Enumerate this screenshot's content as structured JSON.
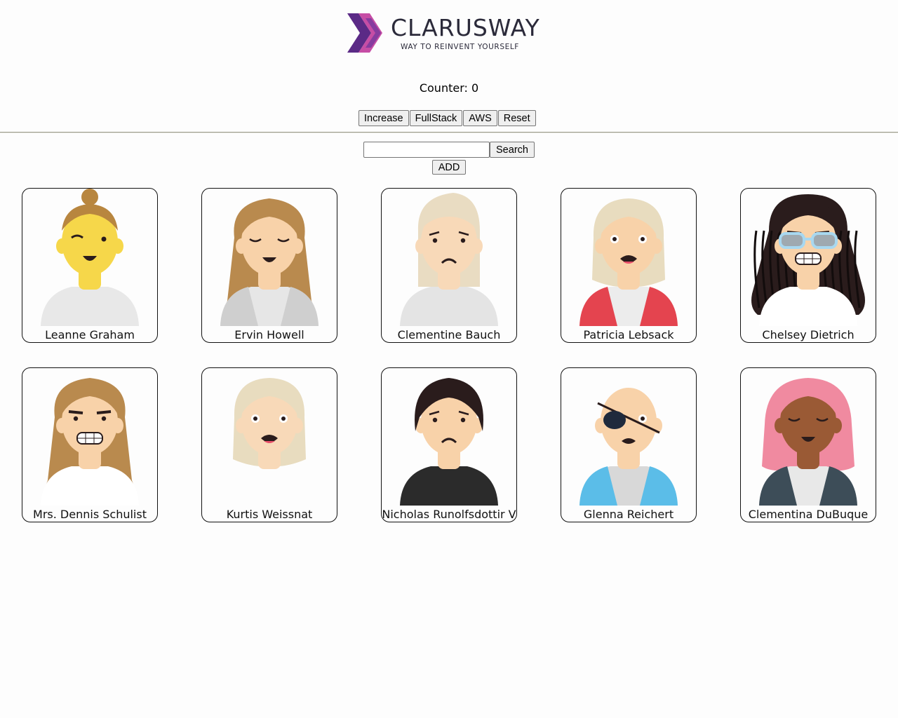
{
  "logo": {
    "name": "CLARUSWAY",
    "tagline": "WAY TO REINVENT YOURSELF",
    "colors": {
      "chevron_dark": "#5b2a86",
      "chevron_light": "#c03a9b",
      "text": "#2b2a3a"
    }
  },
  "counter": {
    "label": "Counter: 0"
  },
  "buttons": {
    "increase": "Increase",
    "fullstack": "FullStack",
    "aws": "AWS",
    "reset": "Reset"
  },
  "search": {
    "value": "",
    "button": "Search"
  },
  "add": {
    "label": "ADD"
  },
  "users": [
    {
      "name": "Leanne Graham",
      "skin": "#f6d74a",
      "hair": "#b8863f",
      "shirt": "#e8e8e8",
      "jacket": "",
      "hair_style": "bun",
      "expression": "wink"
    },
    {
      "name": "Ervin Howell",
      "skin": "#f8d2a9",
      "hair": "#b98a4e",
      "shirt": "#e6e6e6",
      "jacket": "#cfcfcf",
      "hair_style": "long",
      "expression": "smile"
    },
    {
      "name": "Clementine Bauch",
      "skin": "#f8d9b8",
      "hair": "#e9dcc2",
      "shirt": "#e4e4e4",
      "jacket": "",
      "hair_style": "quiff",
      "expression": "sad"
    },
    {
      "name": "Patricia Lebsack",
      "skin": "#f8d2a9",
      "hair": "#e8dcbf",
      "shirt": "#ececec",
      "jacket": "#e4444f",
      "hair_style": "bob",
      "expression": "scared"
    },
    {
      "name": "Chelsey Dietrich",
      "skin": "#f8d2a9",
      "hair": "#2a1c1c",
      "shirt": "#ffffff",
      "jacket": "",
      "hair_style": "dreads",
      "expression": "grimace"
    },
    {
      "name": "Mrs. Dennis Schulist",
      "skin": "#f8d2a9",
      "hair": "#b98a4e",
      "shirt": "#ffffff",
      "jacket": "",
      "hair_style": "wavy",
      "expression": "grimace"
    },
    {
      "name": "Kurtis Weissnat",
      "skin": "#f8d9b8",
      "hair": "#e8dcbf",
      "shirt": "",
      "jacket": "",
      "hair_style": "bob",
      "expression": "scared"
    },
    {
      "name": "Nicholas Runolfsdottir V",
      "skin": "#f8d2a9",
      "hair": "#2a1c1c",
      "shirt": "#2b2b2b",
      "jacket": "",
      "hair_style": "messy",
      "expression": "sad"
    },
    {
      "name": "Glenna Reichert",
      "skin": "#f8d2a9",
      "hair": "",
      "shirt": "#d8d8d8",
      "jacket": "#5bbde8",
      "hair_style": "bald",
      "expression": "eyepatch"
    },
    {
      "name": "Clementina DuBuque",
      "skin": "#9a5a35",
      "hair": "#f08aa0",
      "shirt": "#e8e8e8",
      "jacket": "#3d4d58",
      "hair_style": "bobpink",
      "expression": "smile"
    }
  ]
}
